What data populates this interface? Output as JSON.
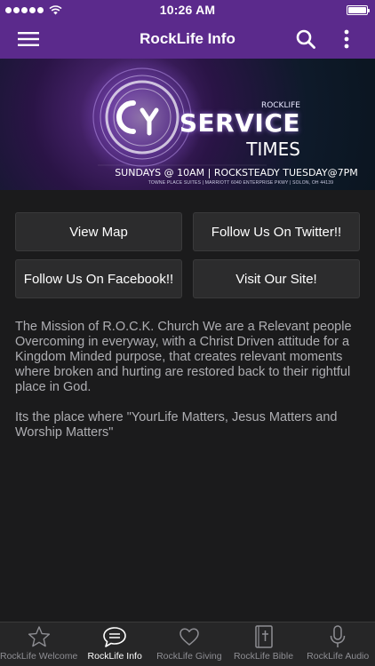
{
  "status_bar": {
    "time": "10:26 AM"
  },
  "nav": {
    "title": "RockLife Info",
    "menu_icon": "hamburger-menu-icon",
    "search_icon": "search-icon",
    "more_icon": "more-vertical-icon"
  },
  "banner": {
    "kicker": "ROCKLIFE",
    "title_line1": "SERVICE",
    "title_line2": "TIMES",
    "schedule": "SUNDAYS @ 10AM | ROCKSTEADY TUESDAY@7PM",
    "address": "TOWNE PLACE SUITES | MARRIOTT 6040 ENTERPRISE PKWY | SOLON, OH 44139"
  },
  "buttons": {
    "view_map": "View Map",
    "twitter": "Follow Us On Twitter!!",
    "facebook": "Follow Us On Facebook!!",
    "site": "Visit Our Site!"
  },
  "mission": {
    "paragraph1": "The Mission of R.O.C.K. Church We are a Relevant people Overcoming in everyway, with a Christ Driven attitude for a Kingdom Minded purpose, that creates relevant moments where broken and hurting are restored back to their rightful place in God.",
    "paragraph2": " Its the place where \"YourLife Matters, Jesus Matters and Worship Matters\""
  },
  "tabs": [
    {
      "label": "RockLife Welcome",
      "icon": "star-icon"
    },
    {
      "label": "RockLife Info",
      "icon": "chat-bubble-icon",
      "active": true
    },
    {
      "label": "RockLife Giving",
      "icon": "heart-icon"
    },
    {
      "label": "RockLife Bible",
      "icon": "bible-icon"
    },
    {
      "label": "RockLife Audio",
      "icon": "microphone-icon"
    }
  ],
  "colors": {
    "nav_purple": "#5b2a8c",
    "background": "#1b1b1c",
    "button_bg": "#2c2c2d",
    "tab_bar_bg": "#262627"
  }
}
